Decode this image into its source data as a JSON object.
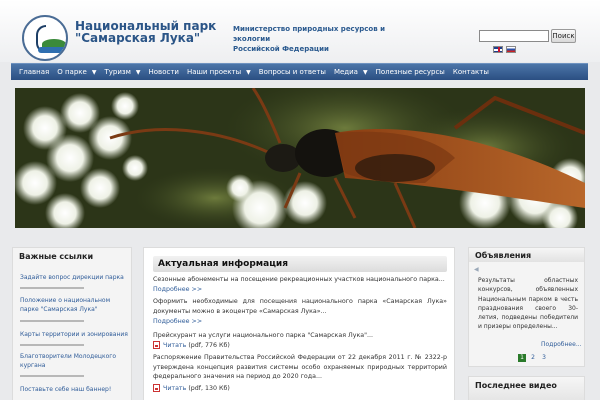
{
  "header": {
    "title_line1": "Национальный парк",
    "title_line2": "\"Самарская Лука\"",
    "ministry_line1": "Министерство природных ресурсов и экологии",
    "ministry_line2": "Российской Федерации",
    "search_placeholder": "",
    "search_button": "Поиск",
    "languages": [
      "english-flag-icon",
      "russian-flag-icon"
    ]
  },
  "nav": {
    "items": [
      {
        "label": "Главная",
        "has_dropdown": false
      },
      {
        "label": "О парке",
        "has_dropdown": true
      },
      {
        "label": "Туризм",
        "has_dropdown": true
      },
      {
        "label": "Новости",
        "has_dropdown": false
      },
      {
        "label": "Наши проекты",
        "has_dropdown": true
      },
      {
        "label": "Вопросы и ответы",
        "has_dropdown": false
      },
      {
        "label": "Медиа",
        "has_dropdown": true
      },
      {
        "label": "Полезные ресурсы",
        "has_dropdown": false
      },
      {
        "label": "Контакты",
        "has_dropdown": false
      }
    ],
    "dropdown_glyph": "▼"
  },
  "left": {
    "title": "Важные ссылки",
    "links": [
      "Задайте вопрос дирекции парка",
      "Положение о национальном парке \"Самарская Лука\"",
      "Карты территории и зонирования",
      "Благотворители Молодецкого кургана",
      "Поставьте себе наш баннер!"
    ]
  },
  "center": {
    "title": "Актуальная информация",
    "news1": "Сезонные абонементы на посещение рекреационных участков национального парка...",
    "more1": "Подробнее >>",
    "news2": "Оформить необходимые для посещения национального парка «Самарская Лука» документы можно в экоцентре «Самарская Лука»...",
    "more2": "Подробнее >>",
    "news3": "Прейскурант на услуги национального парка \"Самарская Лука\"...",
    "doc1_link": "Читать",
    "doc1_info": "(pdf, 776 Кб)",
    "news4": "Распоряжение Правительства Российской Федерации от 22 декабря 2011 г. № 2322-р утверждена концепция развития системы особо охраняемых природных территорий федерального значения на период до 2020 года...",
    "doc2_link": "Читать",
    "doc2_info": "(pdf, 130 Кб)"
  },
  "right": {
    "title": "Объявления",
    "text": "Результаты областных конкурсов, объявленных Национальным парком в честь празднования своего 30-летия, подведены победители и призеры определены...",
    "more": "Подробнее...",
    "pages": [
      "1",
      "2",
      "3"
    ],
    "active_page": "1",
    "video_title": "Последнее видео"
  },
  "colors": {
    "nav_top": "#4c75a8",
    "nav_bottom": "#2b4f82",
    "title_blue": "#2b5587",
    "link_blue": "#2f5c99",
    "active_page_green": "#2a7a2a"
  }
}
